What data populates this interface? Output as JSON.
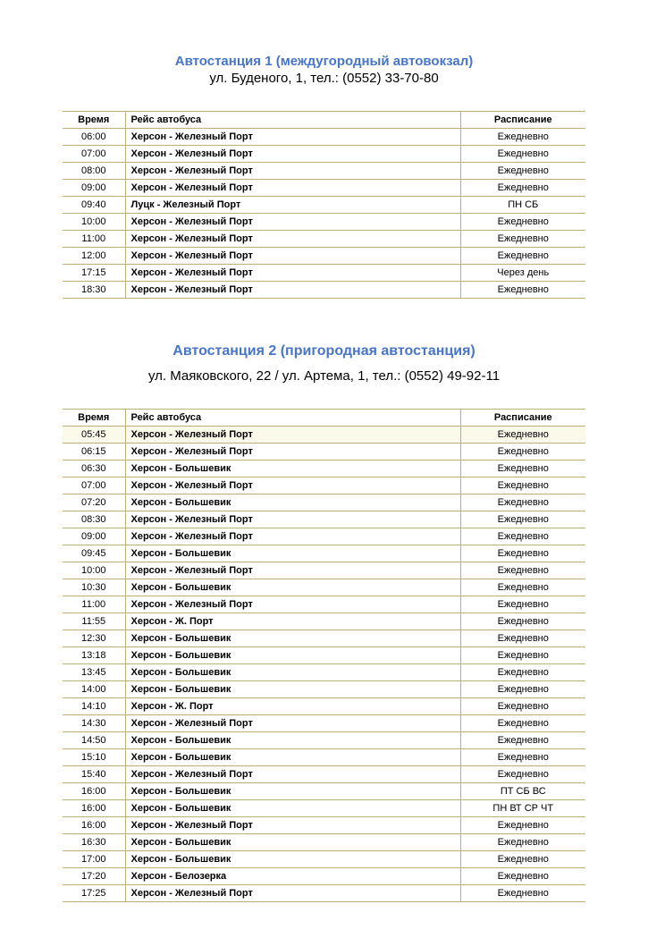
{
  "columns": {
    "time": "Время",
    "route": "Рейс автобуса",
    "schedule": "Расписание"
  },
  "stations": [
    {
      "title": "Автостанция 1 (междугородный автовокзал)",
      "subtitle": "ул. Буденого, 1, тел.: (0552) 33-70-80",
      "class": "",
      "rows": [
        {
          "time": "06:00",
          "route": "Херсон - Железный Порт",
          "schedule": "Ежедневно"
        },
        {
          "time": "07:00",
          "route": "Херсон - Железный Порт",
          "schedule": "Ежедневно"
        },
        {
          "time": "08:00",
          "route": "Херсон - Железный Порт",
          "schedule": "Ежедневно"
        },
        {
          "time": "09:00",
          "route": "Херсон - Железный Порт",
          "schedule": "Ежедневно"
        },
        {
          "time": "09:40",
          "route": "Луцк - Железный Порт",
          "schedule": "ПН СБ"
        },
        {
          "time": "10:00",
          "route": "Херсон - Железный Порт",
          "schedule": "Ежедневно"
        },
        {
          "time": "11:00",
          "route": "Херсон - Железный Порт",
          "schedule": "Ежедневно"
        },
        {
          "time": "12:00",
          "route": "Херсон - Железный Порт",
          "schedule": "Ежедневно"
        },
        {
          "time": "17:15",
          "route": "Херсон - Железный Порт",
          "schedule": "Через день"
        },
        {
          "time": "18:30",
          "route": "Херсон - Железный Порт",
          "schedule": "Ежедневно"
        }
      ]
    },
    {
      "title": "Автостанция 2 (пригородная автостанция)",
      "subtitle": "ул. Маяковского, 22 / ул. Артема, 1, тел.: (0552) 49-92-11",
      "class": "second",
      "rows": [
        {
          "time": "05:45",
          "route": "Херсон - Железный Порт",
          "schedule": "Ежедневно",
          "highlight": true
        },
        {
          "time": "06:15",
          "route": "Херсон - Железный Порт",
          "schedule": "Ежедневно"
        },
        {
          "time": "06:30",
          "route": "Херсон - Большевик",
          "schedule": "Ежедневно"
        },
        {
          "time": "07:00",
          "route": "Херсон - Железный Порт",
          "schedule": "Ежедневно"
        },
        {
          "time": "07:20",
          "route": "Херсон - Большевик",
          "schedule": "Ежедневно"
        },
        {
          "time": "08:30",
          "route": "Херсон - Железный Порт",
          "schedule": "Ежедневно"
        },
        {
          "time": "09:00",
          "route": "Херсон - Железный Порт",
          "schedule": "Ежедневно"
        },
        {
          "time": "09:45",
          "route": "Херсон - Большевик",
          "schedule": "Ежедневно"
        },
        {
          "time": "10:00",
          "route": "Херсон - Железный Порт",
          "schedule": "Ежедневно"
        },
        {
          "time": "10:30",
          "route": "Херсон - Большевик",
          "schedule": "Ежедневно"
        },
        {
          "time": "11:00",
          "route": "Херсон - Железный Порт",
          "schedule": "Ежедневно"
        },
        {
          "time": "11:55",
          "route": "Херсон - Ж. Порт",
          "schedule": "Ежедневно"
        },
        {
          "time": "12:30",
          "route": "Херсон - Большевик",
          "schedule": "Ежедневно"
        },
        {
          "time": "13:18",
          "route": "Херсон - Большевик",
          "schedule": "Ежедневно"
        },
        {
          "time": "13:45",
          "route": "Херсон - Большевик",
          "schedule": "Ежедневно"
        },
        {
          "time": "14:00",
          "route": "Херсон - Большевик",
          "schedule": "Ежедневно"
        },
        {
          "time": "14:10",
          "route": "Херсон - Ж. Порт",
          "schedule": "Ежедневно"
        },
        {
          "time": "14:30",
          "route": "Херсон - Железный Порт",
          "schedule": "Ежедневно"
        },
        {
          "time": "14:50",
          "route": "Херсон - Большевик",
          "schedule": "Ежедневно"
        },
        {
          "time": "15:10",
          "route": "Херсон - Большевик",
          "schedule": "Ежедневно"
        },
        {
          "time": "15:40",
          "route": "Херсон - Железный Порт",
          "schedule": "Ежедневно"
        },
        {
          "time": "16:00",
          "route": "Херсон - Большевик",
          "schedule": "ПТ СБ ВС"
        },
        {
          "time": "16:00",
          "route": "Херсон - Большевик",
          "schedule": "ПН ВТ СР ЧТ"
        },
        {
          "time": "16:00",
          "route": "Херсон - Железный Порт",
          "schedule": "Ежедневно"
        },
        {
          "time": "16:30",
          "route": "Херсон - Большевик",
          "schedule": "Ежедневно"
        },
        {
          "time": "17:00",
          "route": "Херсон - Большевик",
          "schedule": "Ежедневно"
        },
        {
          "time": "17:20",
          "route": "Херсон - Белозерка",
          "schedule": "Ежедневно"
        },
        {
          "time": "17:25",
          "route": "Херсон - Железный Порт",
          "schedule": "Ежедневно"
        }
      ]
    }
  ]
}
